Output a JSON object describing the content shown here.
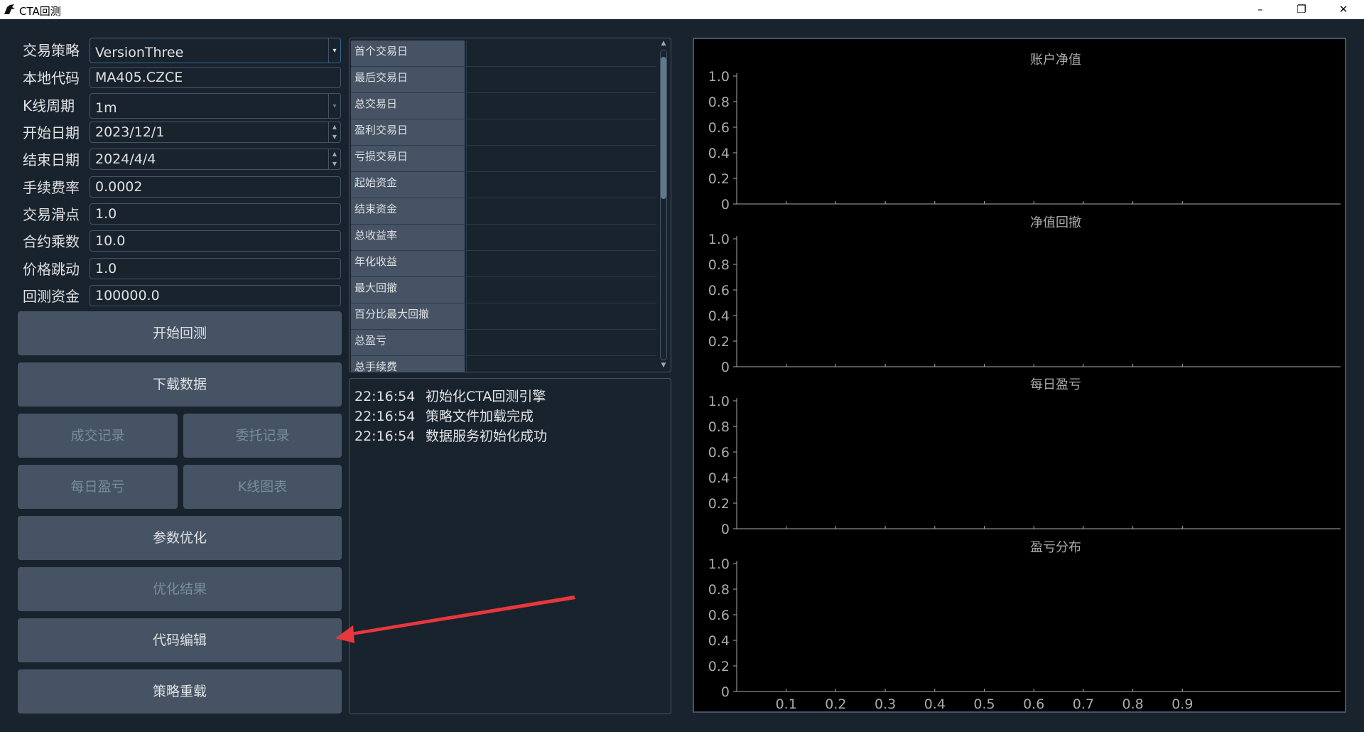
{
  "window": {
    "title": "CTA回测",
    "controls": [
      "–",
      "❐",
      "✕"
    ]
  },
  "form": {
    "fields": [
      {
        "label": "交易策略",
        "value": "VersionThree",
        "kind": "combo"
      },
      {
        "label": "本地代码",
        "value": "MA405.CZCE",
        "kind": "text"
      },
      {
        "label": "K线周期",
        "value": "1m",
        "kind": "combo-disabled"
      },
      {
        "label": "开始日期",
        "value": "2023/12/1",
        "kind": "date"
      },
      {
        "label": "结束日期",
        "value": "2024/4/4",
        "kind": "date"
      },
      {
        "label": "手续费率",
        "value": "0.0002",
        "kind": "text"
      },
      {
        "label": "交易滑点",
        "value": "1.0",
        "kind": "text"
      },
      {
        "label": "合约乘数",
        "value": "10.0",
        "kind": "text"
      },
      {
        "label": "价格跳动",
        "value": "1.0",
        "kind": "text"
      },
      {
        "label": "回测资金",
        "value": "100000.0",
        "kind": "text"
      }
    ]
  },
  "buttons": {
    "start_backtest": "开始回测",
    "download_data": "下载数据",
    "trade_records": "成交记录",
    "order_records": "委托记录",
    "daily_pnl": "每日盈亏",
    "kline_chart": "K线图表",
    "param_optimize": "参数优化",
    "optimize_result": "优化结果",
    "code_edit": "代码编辑",
    "strategy_reload": "策略重载"
  },
  "stats": {
    "rows": [
      "首个交易日",
      "最后交易日",
      "总交易日",
      "盈利交易日",
      "亏损交易日",
      "起始资金",
      "结束资金",
      "总收益率",
      "年化收益",
      "最大回撤",
      "百分比最大回撤",
      "总盈亏",
      "总手续费"
    ]
  },
  "log": {
    "lines": [
      {
        "time": "22:16:54",
        "msg": "初始化CTA回测引擎"
      },
      {
        "time": "22:16:54",
        "msg": "策略文件加载完成"
      },
      {
        "time": "22:16:54",
        "msg": "数据服务初始化成功"
      }
    ]
  },
  "chart_data": [
    {
      "type": "line",
      "title": "账户净值",
      "ylim": [
        0,
        1.0
      ],
      "yticks": [
        "1.0",
        "0.8",
        "0.6",
        "0.4",
        "0.2",
        "0"
      ],
      "series": []
    },
    {
      "type": "line",
      "title": "净值回撤",
      "ylim": [
        0,
        1.0
      ],
      "yticks": [
        "1.0",
        "0.8",
        "0.6",
        "0.4",
        "0.2",
        "0"
      ],
      "series": []
    },
    {
      "type": "bar",
      "title": "每日盈亏",
      "ylim": [
        0,
        1.0
      ],
      "yticks": [
        "1.0",
        "0.8",
        "0.6",
        "0.4",
        "0.2",
        "0"
      ],
      "series": []
    },
    {
      "type": "bar",
      "title": "盈亏分布",
      "ylim": [
        0,
        1.0
      ],
      "yticks": [
        "1.0",
        "0.8",
        "0.6",
        "0.4",
        "0.2",
        "0"
      ],
      "xticks": [
        "0.1",
        "0.2",
        "0.3",
        "0.4",
        "0.5",
        "0.6",
        "0.7",
        "0.8",
        "0.9"
      ],
      "xlim": [
        0,
        1.0
      ],
      "series": []
    }
  ],
  "colors": {
    "background": "#19232d",
    "button": "#455364",
    "chart_bg": "#000000",
    "axis": "#aaaaaa",
    "annotation_arrow": "#e8373d"
  }
}
